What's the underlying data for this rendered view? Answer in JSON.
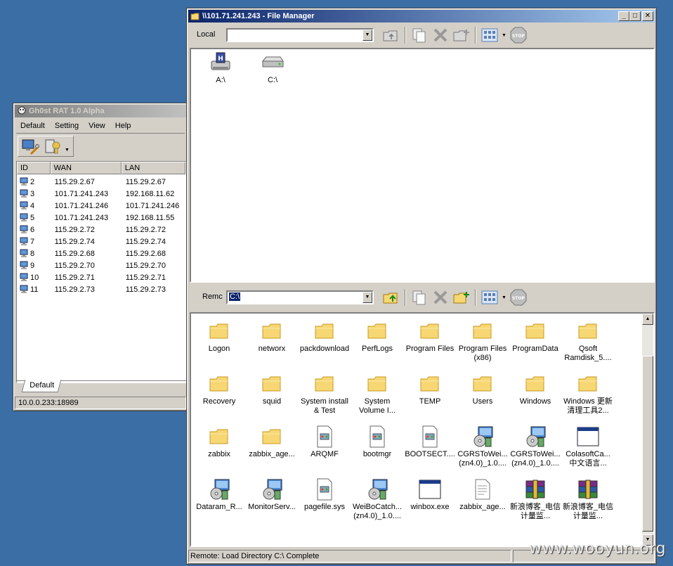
{
  "gh0st": {
    "title": "Gh0st RAT 1.0 Alpha",
    "menu": [
      "Default",
      "Setting",
      "View",
      "Help"
    ],
    "columns": [
      "ID",
      "WAN",
      "LAN"
    ],
    "rows": [
      {
        "id": "2",
        "wan": "115.29.2.67",
        "lan": "115.29.2.67"
      },
      {
        "id": "3",
        "wan": "101.71.241.243",
        "lan": "192.168.11.62"
      },
      {
        "id": "4",
        "wan": "101.71.241.246",
        "lan": "101.71.241.246"
      },
      {
        "id": "5",
        "wan": "101.71.241.243",
        "lan": "192.168.11.55"
      },
      {
        "id": "6",
        "wan": "115.29.2.72",
        "lan": "115.29.2.72"
      },
      {
        "id": "7",
        "wan": "115.29.2.74",
        "lan": "115.29.2.74"
      },
      {
        "id": "8",
        "wan": "115.29.2.68",
        "lan": "115.29.2.68"
      },
      {
        "id": "9",
        "wan": "115.29.2.70",
        "lan": "115.29.2.70"
      },
      {
        "id": "10",
        "wan": "115.29.2.71",
        "lan": "115.29.2.71"
      },
      {
        "id": "11",
        "wan": "115.29.2.73",
        "lan": "115.29.2.73"
      }
    ],
    "tab": "Default",
    "status": "10.0.0.233:18989"
  },
  "fm": {
    "title": "\\\\101.71.241.243 - File Manager",
    "local_label": "Local",
    "local_value": "",
    "remote_label": "Remc",
    "remote_value": "C:\\",
    "drives": [
      {
        "label": "A:\\",
        "icon": "floppy-drive-icon"
      },
      {
        "label": "C:\\",
        "icon": "hard-drive-icon"
      }
    ],
    "files": [
      {
        "name": "Logon",
        "icon": "folder"
      },
      {
        "name": "networx",
        "icon": "folder"
      },
      {
        "name": "packdownload",
        "icon": "folder"
      },
      {
        "name": "PerfLogs",
        "icon": "folder"
      },
      {
        "name": "Program Files",
        "icon": "folder"
      },
      {
        "name": "Program Files (x86)",
        "icon": "folder"
      },
      {
        "name": "ProgramData",
        "icon": "folder"
      },
      {
        "name": "Qsoft Ramdisk_5....",
        "icon": "folder"
      },
      {
        "name": "Recovery",
        "icon": "folder"
      },
      {
        "name": "squid",
        "icon": "folder"
      },
      {
        "name": "System install & Test",
        "icon": "folder"
      },
      {
        "name": "System Volume I...",
        "icon": "folder"
      },
      {
        "name": "TEMP",
        "icon": "folder"
      },
      {
        "name": "Users",
        "icon": "folder"
      },
      {
        "name": "Windows",
        "icon": "folder"
      },
      {
        "name": "Windows 更新清理工具2...",
        "icon": "folder"
      },
      {
        "name": "zabbix",
        "icon": "folder"
      },
      {
        "name": "zabbix_age...",
        "icon": "folder"
      },
      {
        "name": "ARQMF",
        "icon": "sysfile"
      },
      {
        "name": "bootmgr",
        "icon": "sysfile"
      },
      {
        "name": "BOOTSECT....",
        "icon": "sysfile"
      },
      {
        "name": "CGRSToWei... (zn4.0)_1.0....",
        "icon": "installer"
      },
      {
        "name": "CGRSToWei... (zn4.0)_1.0....",
        "icon": "installer"
      },
      {
        "name": "ColasoftCa... 中文语言...",
        "icon": "exe"
      },
      {
        "name": "Dataram_R...",
        "icon": "installer"
      },
      {
        "name": "MonitorServ...",
        "icon": "installer"
      },
      {
        "name": "pagefile.sys",
        "icon": "sysfile"
      },
      {
        "name": "WeiBoCatch... (zn4.0)_1.0....",
        "icon": "installer"
      },
      {
        "name": "winbox.exe",
        "icon": "exe"
      },
      {
        "name": "zabbix_age...",
        "icon": "textfile"
      },
      {
        "name": "新浪博客_电信计量监...",
        "icon": "rar"
      },
      {
        "name": "新浪博客_电信计量监...",
        "icon": "rar"
      }
    ],
    "status": "Remote: Load Directory C:\\ Complete"
  },
  "watermark": "www.wooyun.org",
  "colors": {
    "desktop": "#3a6ea5",
    "folder": "#f7d774",
    "title_active": "#0a246a"
  }
}
